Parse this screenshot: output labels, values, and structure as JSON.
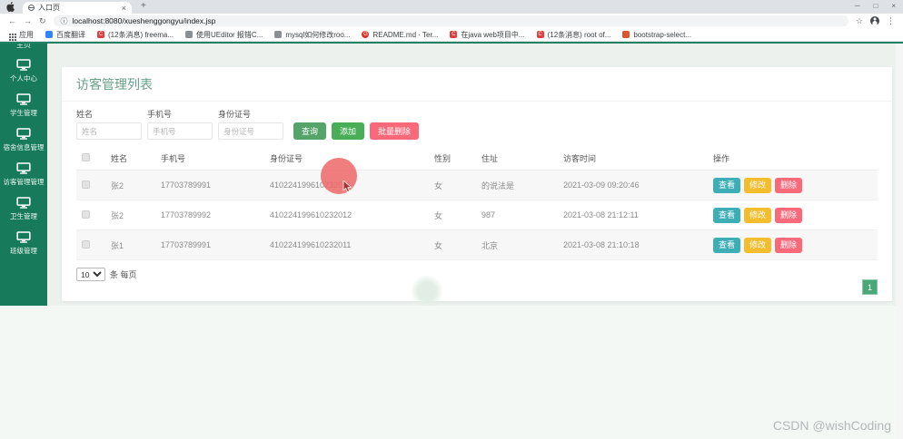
{
  "browser": {
    "tab": {
      "title": "入口页",
      "close_glyph": "×"
    },
    "new_tab_glyph": "+",
    "window_controls": {
      "minimize": "─",
      "maximize": "□",
      "close": "×"
    },
    "nav": {
      "back": "←",
      "forward": "→",
      "reload": "↻",
      "info": "ⓘ",
      "url": "localhost:8080/xueshenggongyu/index.jsp",
      "star": "☆",
      "menu": "⋮"
    },
    "bookmarks": [
      {
        "label": "应用",
        "icon": "apps-grid-icon",
        "glyph": ""
      },
      {
        "label": "百度翻译",
        "icon": "baidu-translate-icon",
        "glyph": ""
      },
      {
        "label": "(12条消息) freema...",
        "icon": "csdn-icon",
        "glyph": "C"
      },
      {
        "label": "使用UEditor 报错C...",
        "icon": "doc-icon",
        "glyph": ""
      },
      {
        "label": "mysql如何修改roo...",
        "icon": "doc-icon",
        "glyph": ""
      },
      {
        "label": "README.md · Ter...",
        "icon": "gitee-icon",
        "glyph": "G"
      },
      {
        "label": "在java web项目中...",
        "icon": "csdn-icon",
        "glyph": "C"
      },
      {
        "label": "(12条消息) root of...",
        "icon": "csdn-icon",
        "glyph": "C"
      },
      {
        "label": "bootstrap-select...",
        "icon": "bootstrap-icon",
        "glyph": ""
      }
    ]
  },
  "sidebar": {
    "top_clipped_item": "主页",
    "items": [
      {
        "label": "个人中心"
      },
      {
        "label": "学生管理"
      },
      {
        "label": "宿舍信息管理"
      },
      {
        "label": "访客管理管理"
      },
      {
        "label": "卫生管理"
      },
      {
        "label": "班级管理"
      }
    ]
  },
  "page": {
    "title": "访客管理列表",
    "filters": [
      {
        "label": "姓名",
        "placeholder": "姓名",
        "value": ""
      },
      {
        "label": "手机号",
        "placeholder": "手机号",
        "value": ""
      },
      {
        "label": "身份证号",
        "placeholder": "身份证号",
        "value": ""
      }
    ],
    "actions": {
      "search": "查询",
      "add": "添加",
      "batch_delete": "批量删除"
    },
    "table": {
      "headers": [
        "姓名",
        "手机号",
        "身份证号",
        "性别",
        "住址",
        "访客时间",
        "操作"
      ],
      "row_actions": {
        "view": "查看",
        "edit": "修改",
        "delete": "删除"
      },
      "rows": [
        {
          "name": "张2",
          "phone": "17703789991",
          "id_card": "410224199610232011",
          "gender": "女",
          "address": "的说法是",
          "time": "2021-03-09 09:20:46"
        },
        {
          "name": "张2",
          "phone": "17703789992",
          "id_card": "410224199610232012",
          "gender": "女",
          "address": "987",
          "time": "2021-03-08 21:12:11"
        },
        {
          "name": "张1",
          "phone": "17703789991",
          "id_card": "410224199610232011",
          "gender": "女",
          "address": "北京",
          "time": "2021-03-08 21:10:18"
        }
      ]
    },
    "pagination": {
      "page_size": "10",
      "per_page_label": "条 每页",
      "current_page": "1"
    }
  },
  "watermark": "CSDN @wishCoding",
  "colors": {
    "sidebar_green": "#177a5b",
    "title_green": "#66a186",
    "button_search": "#55a56a",
    "button_add": "#49ae57",
    "button_danger": "#f8697a",
    "button_view": "#3daeb6",
    "button_edit": "#f4bd2e",
    "page_number_green": "#4aa878",
    "cursor_highlight": "#ee6767"
  }
}
